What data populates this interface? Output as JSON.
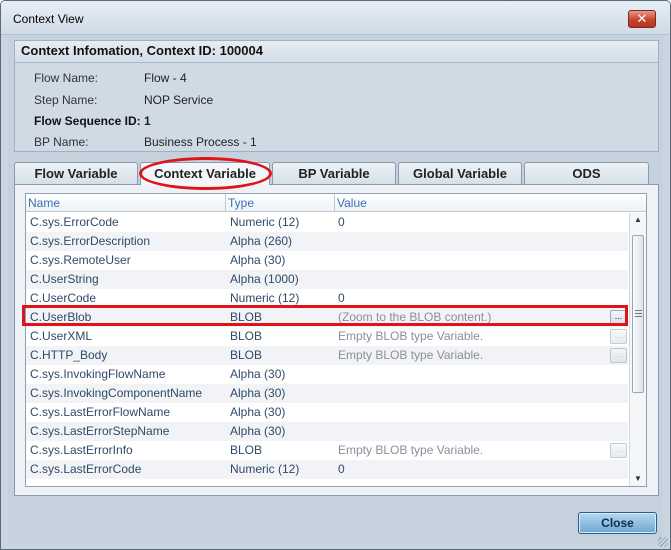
{
  "window": {
    "title": "Context View",
    "close_icon": "close-icon"
  },
  "info": {
    "header": "Context Infomation, Context ID: 100004",
    "flow_name_label": "Flow Name:",
    "flow_name_value": "Flow - 4",
    "step_name_label": "Step Name:",
    "step_name_value": "NOP Service",
    "flow_seq_label": "Flow Sequence ID:",
    "flow_seq_value": "1",
    "bp_name_label": "BP Name:",
    "bp_name_value": "Business Process - 1"
  },
  "tabs": [
    {
      "label": "Flow Variable"
    },
    {
      "label": "Context Variable",
      "active": true
    },
    {
      "label": "BP Variable"
    },
    {
      "label": "Global Variable"
    },
    {
      "label": "ODS"
    }
  ],
  "table": {
    "columns": [
      "Name",
      "Type",
      "Value"
    ],
    "rows": [
      {
        "name": "C.sys.ErrorCode",
        "type": "Numeric (12)",
        "value": "0"
      },
      {
        "name": "C.sys.ErrorDescription",
        "type": "Alpha (260)",
        "value": ""
      },
      {
        "name": "C.sys.RemoteUser",
        "type": "Alpha (30)",
        "value": ""
      },
      {
        "name": "C.UserString",
        "type": "Alpha (1000)",
        "value": ""
      },
      {
        "name": "C.UserCode",
        "type": "Numeric (12)",
        "value": "0"
      },
      {
        "name": "C.UserBlob",
        "type": "BLOB",
        "value": "(Zoom to the BLOB content.)",
        "button": "...",
        "highlighted": true
      },
      {
        "name": "C.UserXML",
        "type": "BLOB",
        "value": "Empty BLOB type Variable.",
        "button": "..."
      },
      {
        "name": "C.HTTP_Body",
        "type": "BLOB",
        "value": "Empty BLOB type Variable.",
        "button": "..."
      },
      {
        "name": "C.sys.InvokingFlowName",
        "type": "Alpha (30)",
        "value": ""
      },
      {
        "name": "C.sys.InvokingComponentName",
        "type": "Alpha (30)",
        "value": ""
      },
      {
        "name": "C.sys.LastErrorFlowName",
        "type": "Alpha (30)",
        "value": ""
      },
      {
        "name": "C.sys.LastErrorStepName",
        "type": "Alpha (30)",
        "value": ""
      },
      {
        "name": "C.sys.LastErrorInfo",
        "type": "BLOB",
        "value": "Empty BLOB type Variable.",
        "button": "..."
      },
      {
        "name": "C.sys.LastErrorCode",
        "type": "Numeric (12)",
        "value": "0"
      }
    ]
  },
  "footer": {
    "close_label": "Close"
  },
  "colors": {
    "highlight": "#e0131a",
    "header_text": "#3a70b2"
  }
}
